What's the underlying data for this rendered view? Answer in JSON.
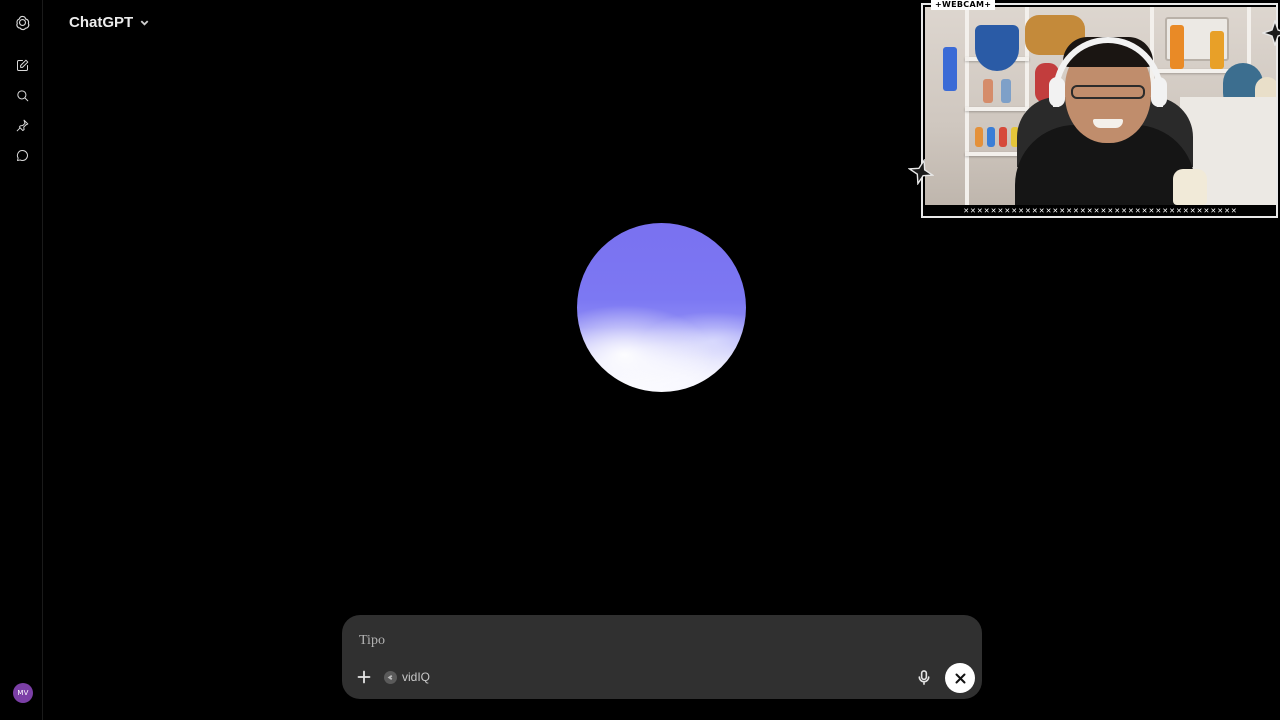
{
  "header": {
    "model_name": "ChatGPT"
  },
  "sidebar": {
    "items": [
      {
        "icon": "openai-logo-icon",
        "label": "ChatGPT home"
      },
      {
        "icon": "new-chat-icon",
        "label": "New chat"
      },
      {
        "icon": "search-icon",
        "label": "Search chats"
      },
      {
        "icon": "pin-icon",
        "label": "Pinned"
      },
      {
        "icon": "chat-bubble-icon",
        "label": "Chats"
      }
    ],
    "avatar_initials": "MV"
  },
  "voice": {
    "orb_colors": [
      "#7a71f0",
      "#ffffff"
    ]
  },
  "composer": {
    "placeholder": "Tipo",
    "tool_chip_label": "vidIQ"
  },
  "webcam": {
    "tag_label": "+WEBCAM+",
    "strip_text": "✕✕✕✕✕✕✕✕✕✕✕✕✕✕✕✕✕✕✕✕✕✕✕✕✕✕✕✕✕✕✕✕✕✕✕✕✕✕✕✕"
  }
}
